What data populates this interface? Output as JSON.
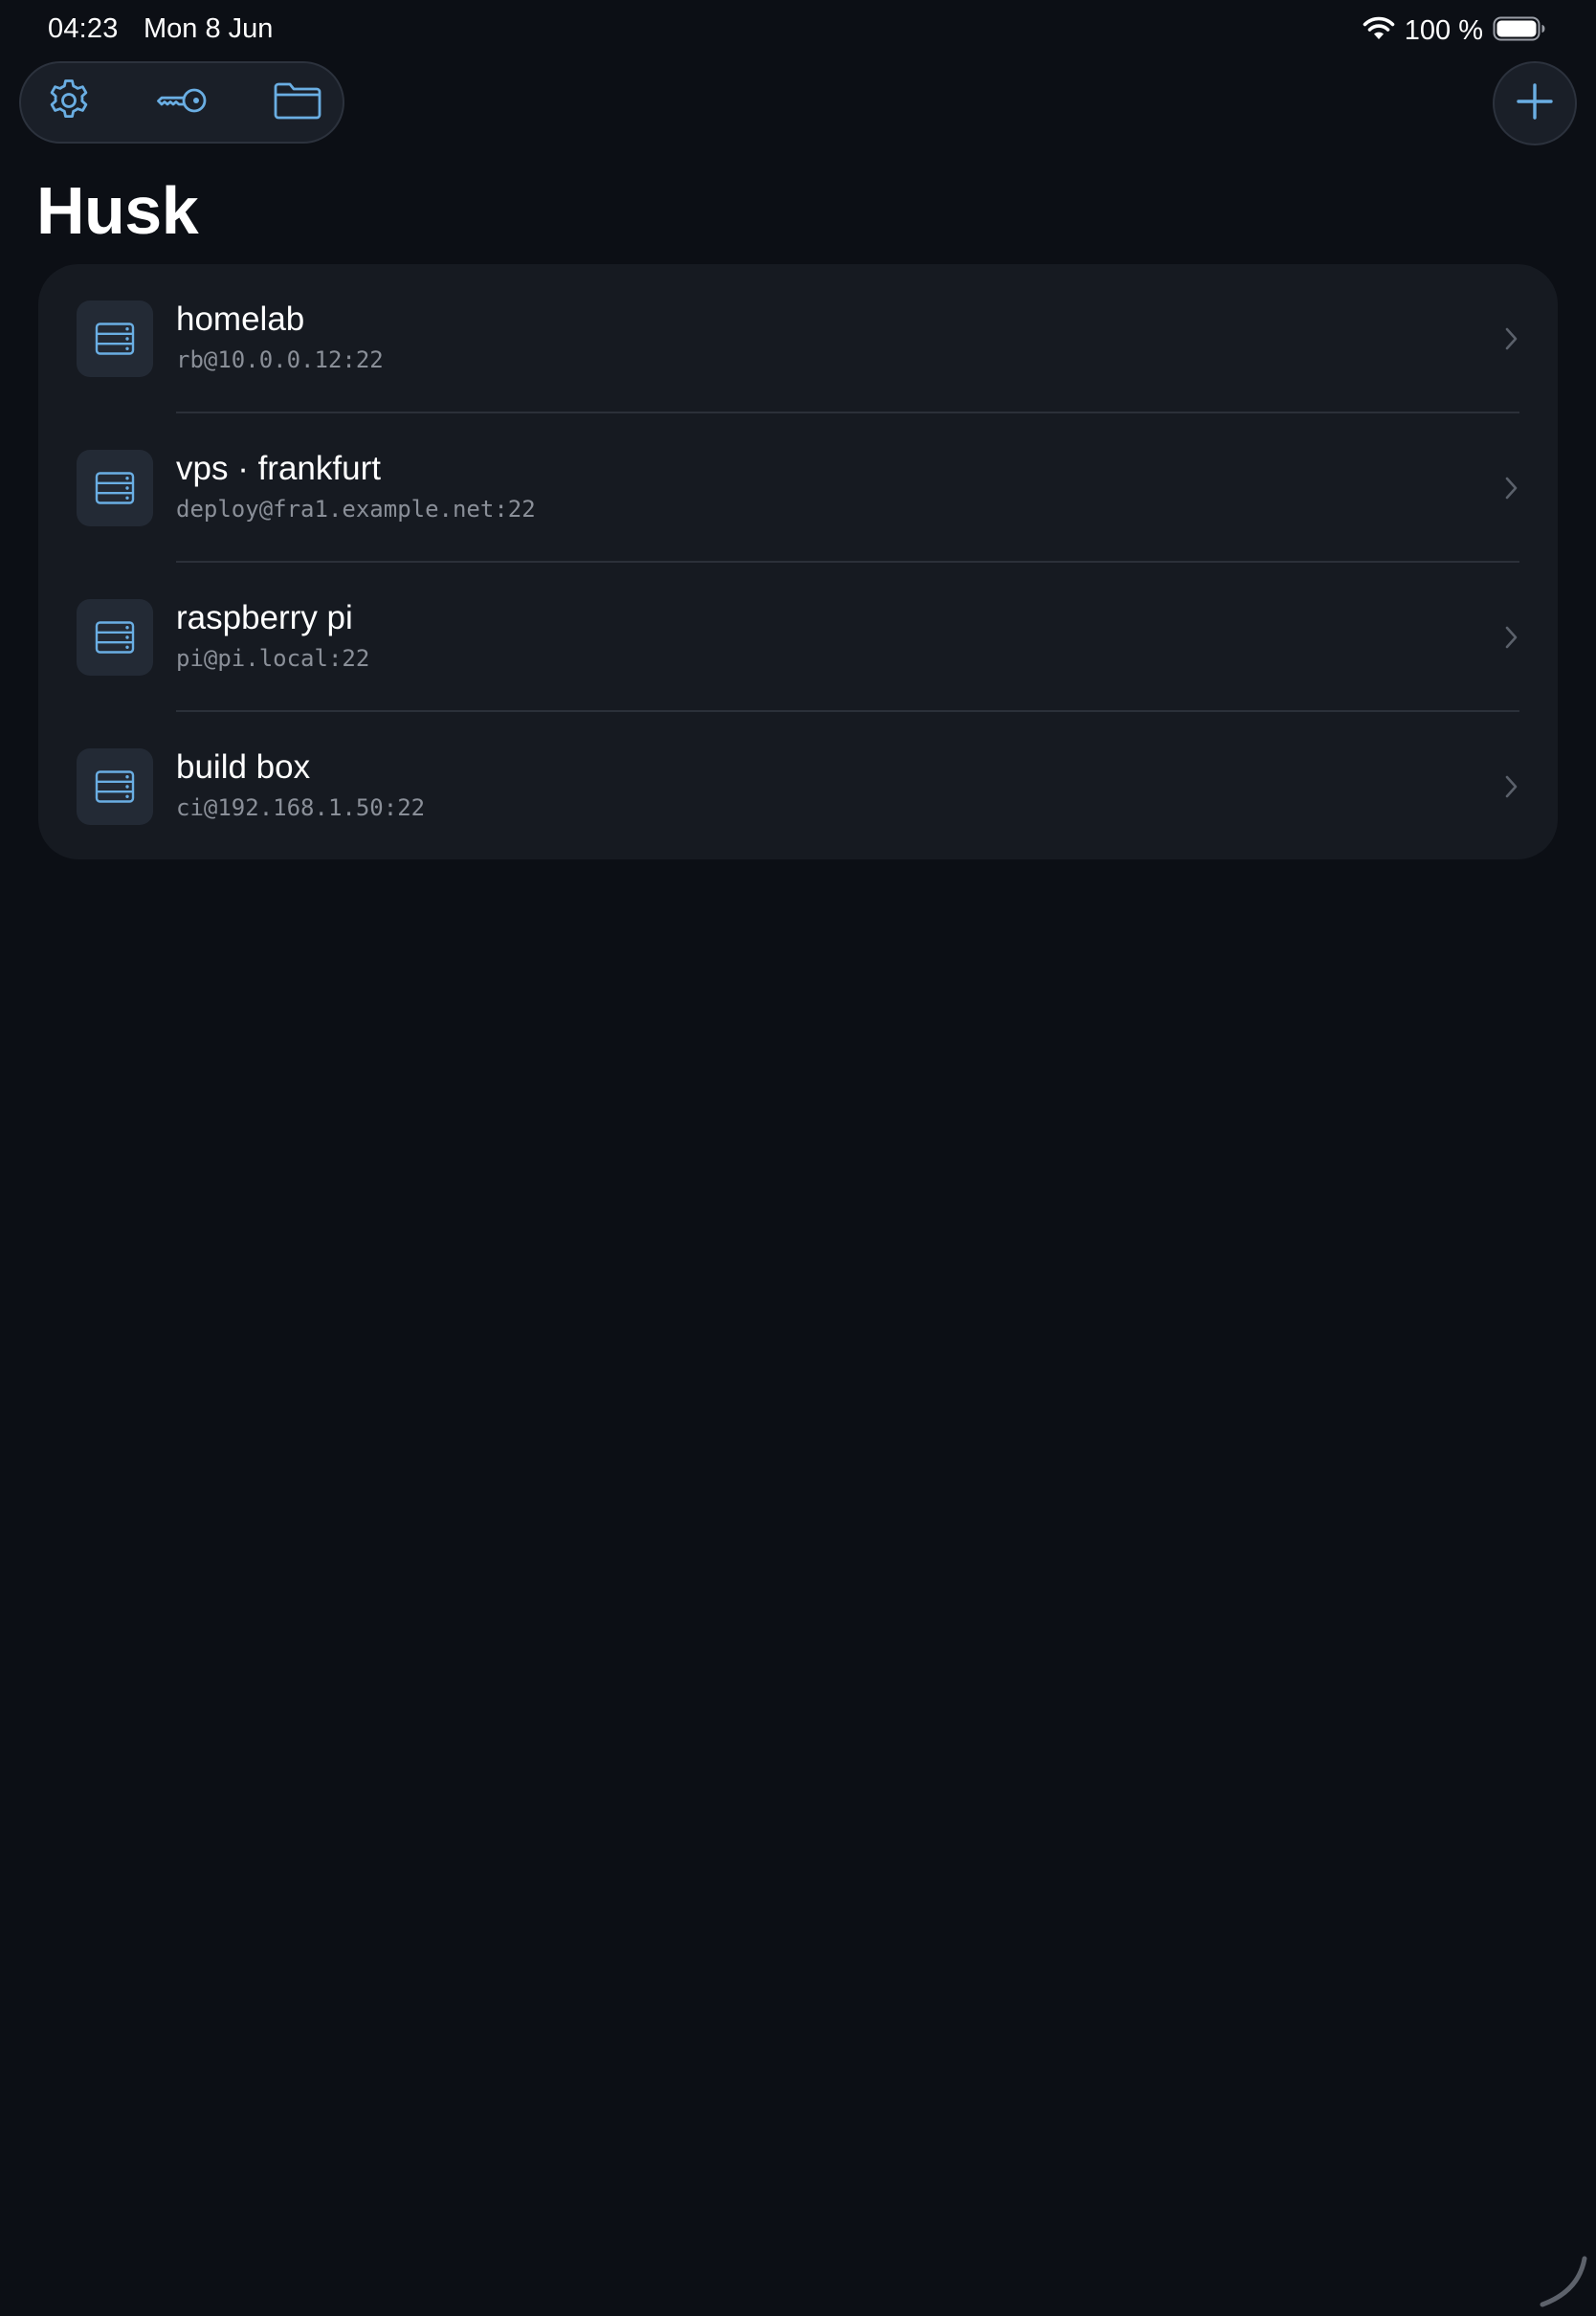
{
  "status_bar": {
    "time": "04:23",
    "date": "Mon 8 Jun",
    "battery_percent": "100 %",
    "wifi_icon": "wifi-icon",
    "battery_icon": "battery-full-icon"
  },
  "toolbar": {
    "settings_icon": "gear-icon",
    "keys_icon": "key-icon",
    "files_icon": "folder-icon",
    "add_icon": "plus-icon"
  },
  "page": {
    "title": "Husk"
  },
  "hosts": [
    {
      "name": "homelab",
      "address": "rb@10.0.0.12:22",
      "icon": "server-icon"
    },
    {
      "name": "vps · frankfurt",
      "address": "deploy@fra1.example.net:22",
      "icon": "server-icon"
    },
    {
      "name": "raspberry pi",
      "address": "pi@pi.local:22",
      "icon": "server-icon"
    },
    {
      "name": "build box",
      "address": "ci@192.168.1.50:22",
      "icon": "server-icon"
    }
  ],
  "colors": {
    "background": "#0c0f15",
    "card": "#161a21",
    "accent": "#6aaee3",
    "secondary_text": "#8a8f98"
  }
}
